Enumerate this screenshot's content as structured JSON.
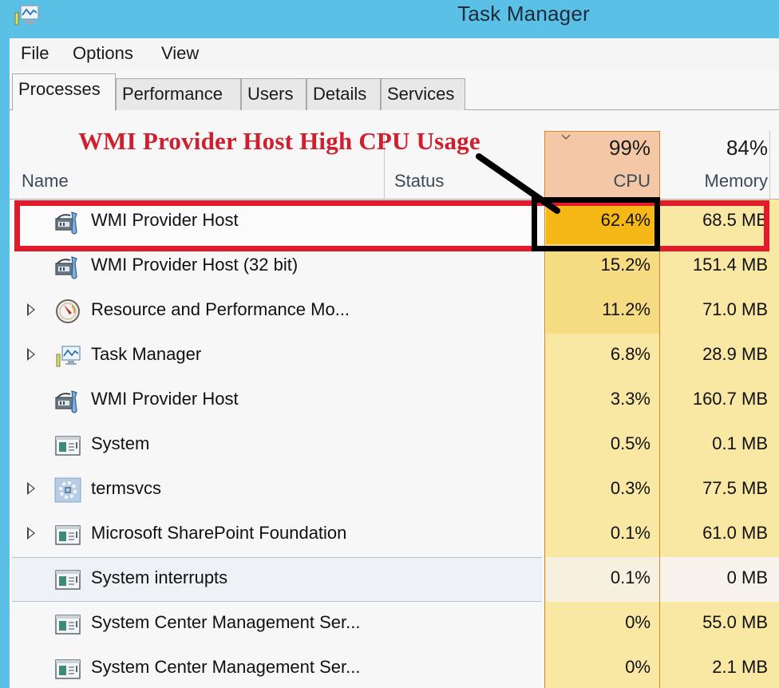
{
  "window": {
    "title": "Task Manager",
    "app_icon": "task-manager-icon"
  },
  "menu": {
    "items": [
      "File",
      "Options",
      "View"
    ]
  },
  "tabs": [
    {
      "label": "Processes",
      "active": true
    },
    {
      "label": "Performance",
      "active": false
    },
    {
      "label": "Users",
      "active": false
    },
    {
      "label": "Details",
      "active": false
    },
    {
      "label": "Services",
      "active": false
    }
  ],
  "annotation": {
    "text": "WMI Provider Host High CPU Usage",
    "color": "#cf1f2e"
  },
  "columns": {
    "name": "Name",
    "status": "Status",
    "cpu": {
      "label": "CPU",
      "total": "99%",
      "sorted": true
    },
    "memory": {
      "label": "Memory",
      "total": "84%"
    }
  },
  "colors": {
    "titlebar": "#5bc0e5",
    "heat_low": "#f8e8a3",
    "heat_mid": "#f5dc82",
    "heat_high": "#f6b816",
    "cpu_header": "#f4c8a6",
    "highlight_red": "#e21b2c"
  },
  "processes": [
    {
      "name": "WMI Provider Host",
      "icon": "wmi-host-icon",
      "expandable": false,
      "status": "",
      "cpu": "62.4%",
      "memory": "68.5 MB",
      "highlighted": true
    },
    {
      "name": "WMI Provider Host (32 bit)",
      "icon": "wmi-host-icon",
      "expandable": false,
      "status": "",
      "cpu": "15.2%",
      "memory": "151.4 MB"
    },
    {
      "name": "Resource and Performance Mo...",
      "icon": "resource-monitor-icon",
      "expandable": true,
      "status": "",
      "cpu": "11.2%",
      "memory": "71.0 MB"
    },
    {
      "name": "Task Manager",
      "icon": "task-manager-icon",
      "expandable": true,
      "status": "",
      "cpu": "6.8%",
      "memory": "28.9 MB"
    },
    {
      "name": "WMI Provider Host",
      "icon": "wmi-host-icon",
      "expandable": false,
      "status": "",
      "cpu": "3.3%",
      "memory": "160.7 MB"
    },
    {
      "name": "System",
      "icon": "system-window-icon",
      "expandable": false,
      "status": "",
      "cpu": "0.5%",
      "memory": "0.1 MB"
    },
    {
      "name": "termsvcs",
      "icon": "service-gear-icon",
      "expandable": true,
      "status": "",
      "cpu": "0.3%",
      "memory": "77.5 MB"
    },
    {
      "name": "Microsoft SharePoint Foundation",
      "icon": "system-window-icon",
      "expandable": true,
      "status": "",
      "cpu": "0.1%",
      "memory": "61.0 MB"
    },
    {
      "name": "System interrupts",
      "icon": "system-window-icon",
      "expandable": false,
      "status": "",
      "cpu": "0.1%",
      "memory": "0 MB",
      "hovered": true
    },
    {
      "name": "System Center Management Ser...",
      "icon": "system-window-icon",
      "expandable": false,
      "status": "",
      "cpu": "0%",
      "memory": "55.0 MB"
    },
    {
      "name": "System Center Management Ser...",
      "icon": "system-window-icon",
      "expandable": false,
      "status": "",
      "cpu": "0%",
      "memory": "2.1 MB"
    }
  ]
}
